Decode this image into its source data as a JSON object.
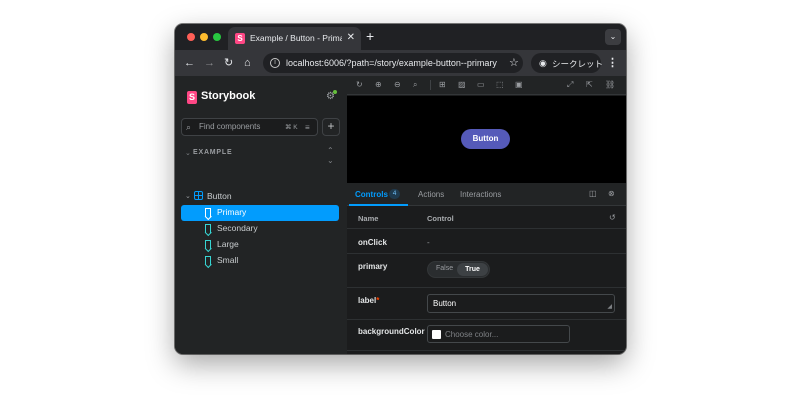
{
  "browser": {
    "tab_title": "Example / Button - Primary -",
    "tab_close": "✕",
    "new_tab": "+",
    "url_host": "localhost",
    "url_rest": ":6006/?path=/story/example-button--primary",
    "incognito_label": "シークレット"
  },
  "sidebar": {
    "title": "Storybook",
    "search_placeholder": "Find components",
    "search_shortcut": "⌘ K",
    "group_label": "EXAMPLE",
    "component": "Button",
    "stories": [
      "Primary",
      "Secondary",
      "Large",
      "Small"
    ],
    "selected_story": "Primary"
  },
  "preview": {
    "button_label": "Button"
  },
  "addons": {
    "tabs": [
      "Controls",
      "Actions",
      "Interactions"
    ],
    "controls_count": "4",
    "active_tab": "Controls"
  },
  "controls": {
    "col_name": "Name",
    "col_control": "Control",
    "rows": {
      "onclick": {
        "name": "onClick",
        "value": "-"
      },
      "primary": {
        "name": "primary",
        "false_label": "False",
        "true_label": "True",
        "value": true
      },
      "label": {
        "name": "label",
        "required_mark": "*",
        "value": "Button"
      },
      "background": {
        "name": "backgroundColor",
        "placeholder": "Choose color..."
      }
    }
  },
  "colors": {
    "accent": "#029cfd",
    "brand": "#ff4785",
    "primary_button": "#555ab9"
  }
}
